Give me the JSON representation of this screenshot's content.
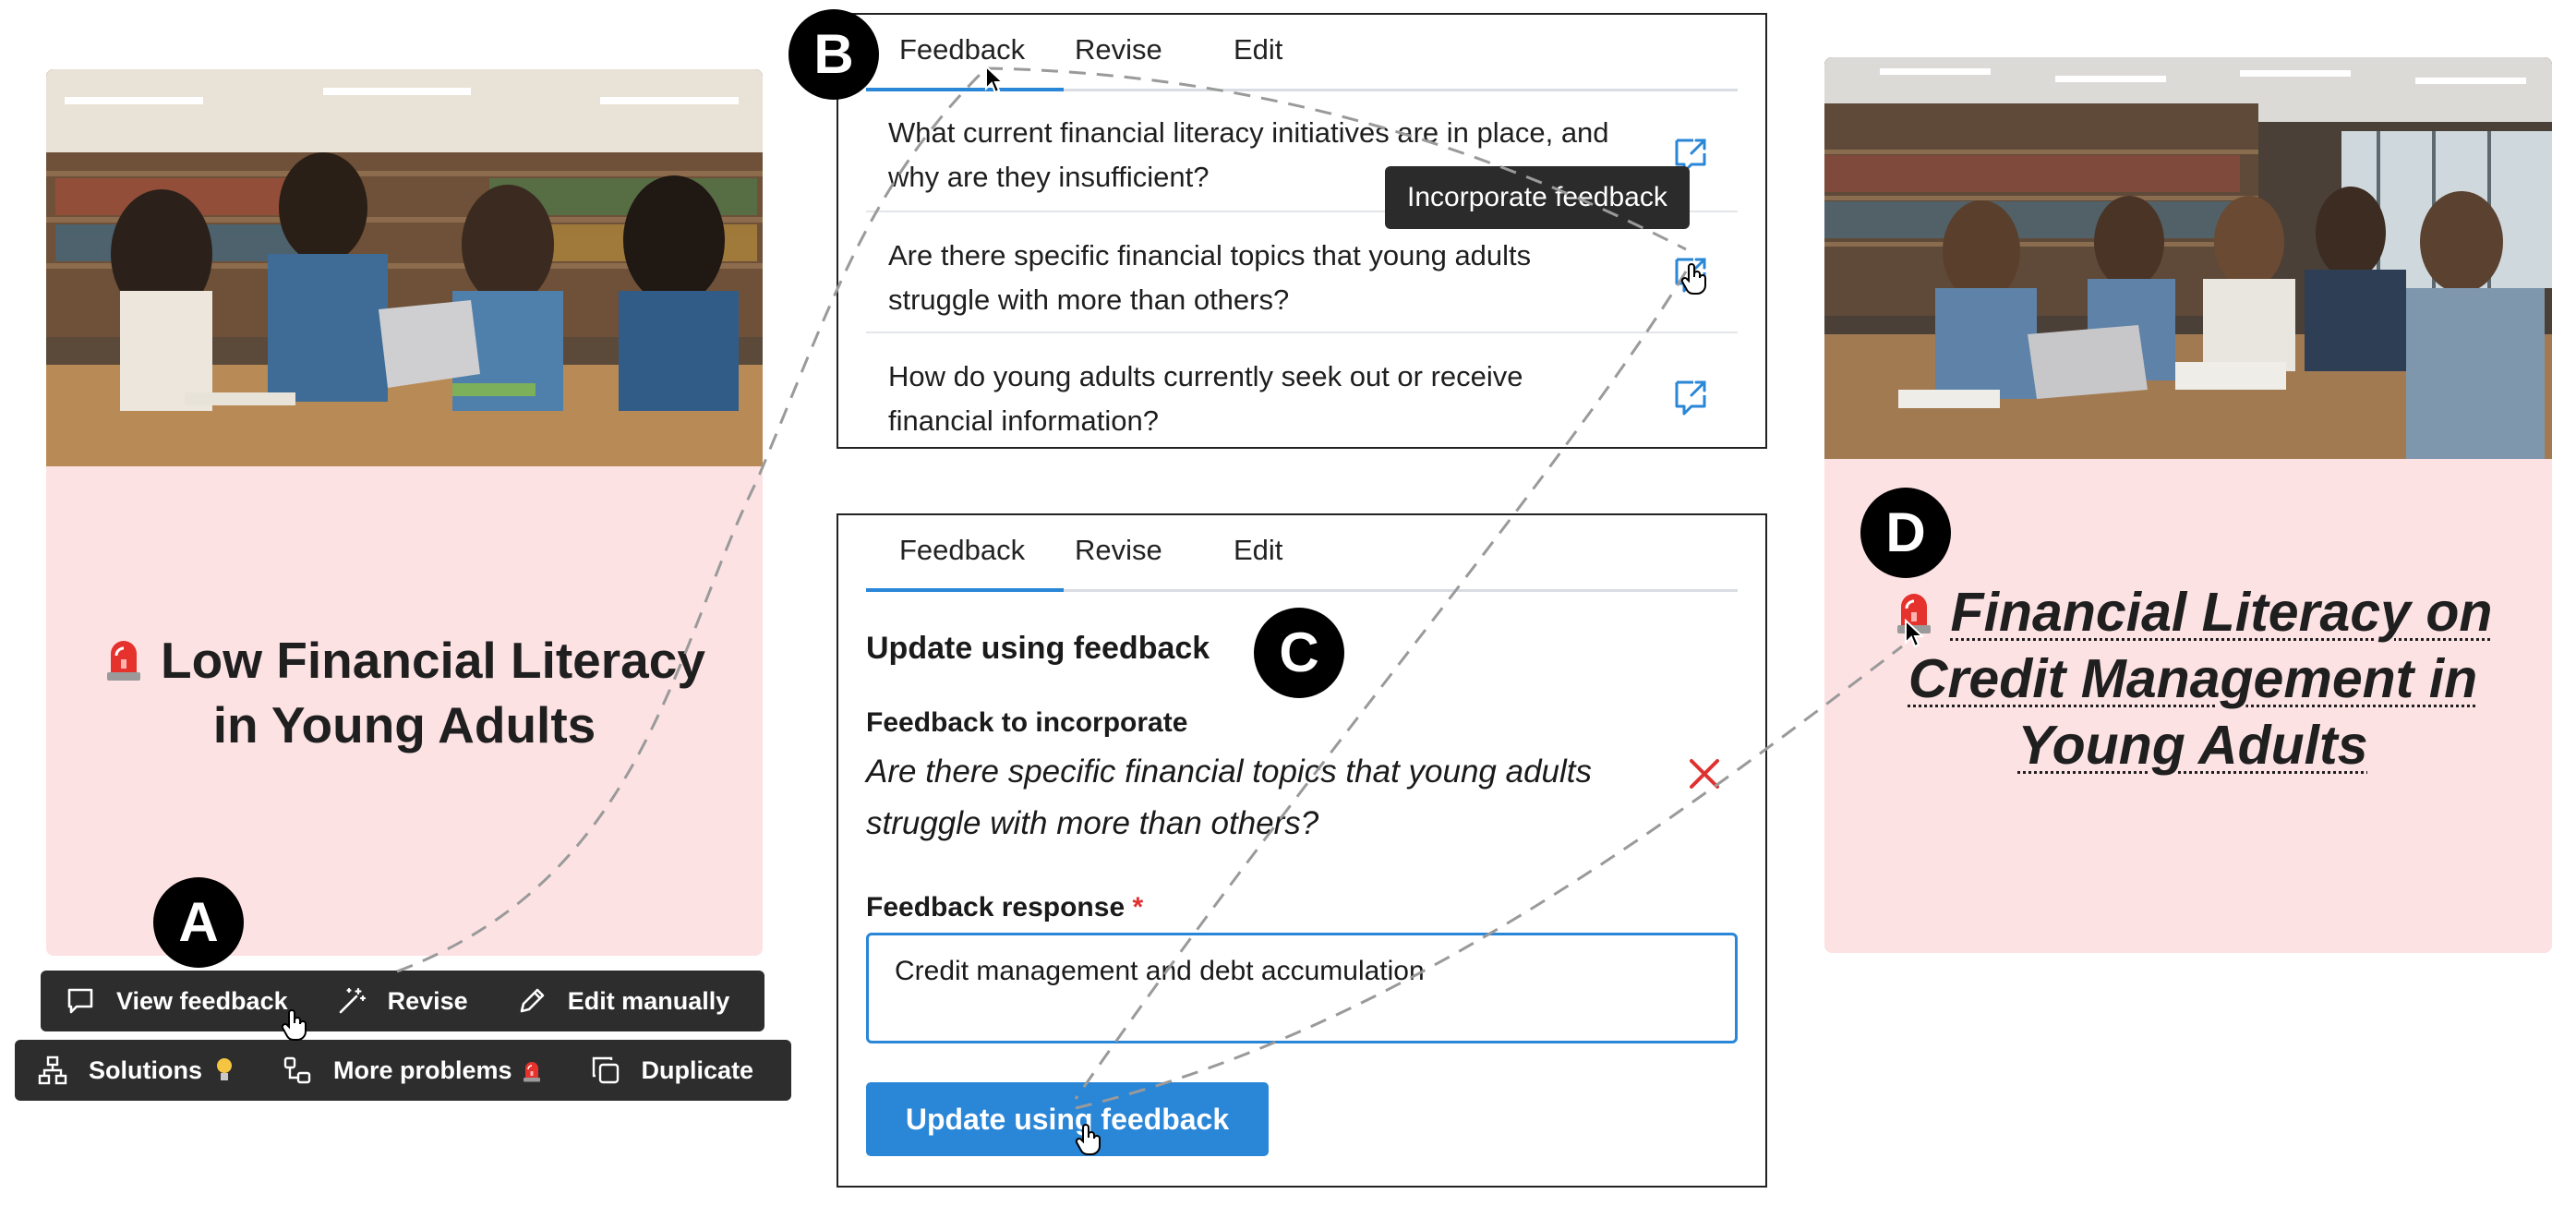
{
  "card_a": {
    "title": "Low Financial Literacy in Young Adults",
    "badge": "A",
    "toolbar_row1": [
      "View feedback",
      "Revise",
      "Edit manually"
    ],
    "toolbar_row2": [
      "Solutions",
      "More problems",
      "Duplicate"
    ]
  },
  "panel_b": {
    "badge": "B",
    "tabs": [
      "Feedback",
      "Revise",
      "Edit"
    ],
    "active_tab": "Feedback",
    "questions": [
      "What current financial literacy initiatives are in place, and why are they insufficient?",
      "Are there specific financial topics that young adults struggle with more than others?",
      "How do young adults currently seek out or receive financial information?"
    ],
    "tooltip": "Incorporate feedback"
  },
  "panel_c": {
    "badge": "C",
    "tabs": [
      "Feedback",
      "Revise",
      "Edit"
    ],
    "heading": "Update using feedback",
    "feedback_label": "Feedback to incorporate",
    "feedback_text": "Are there specific financial topics that young adults struggle with more than others?",
    "response_label": "Feedback response",
    "required_mark": "*",
    "response_value": "Credit management and debt accumulation",
    "submit_label": "Update using feedback"
  },
  "card_d": {
    "badge": "D",
    "title": "Financial Literacy on Credit Management in Young Adults"
  },
  "icons": {
    "toolbar_row1": [
      "speech-bubble-icon",
      "magic-wand-icon",
      "pencil-icon"
    ],
    "toolbar_row2": [
      "hierarchy-icon",
      "branch-copy-icon",
      "duplicate-icon"
    ],
    "question_action": "incorporate-feedback-icon",
    "remove": "close-x-icon",
    "siren": "siren-emoji-icon",
    "bulb": "lightbulb-emoji-icon"
  },
  "colors": {
    "card_background": "#fde2e4",
    "accent_blue": "#2a86d7",
    "toolbar_dark": "#2d2d2d",
    "remove_red": "#e03131"
  }
}
